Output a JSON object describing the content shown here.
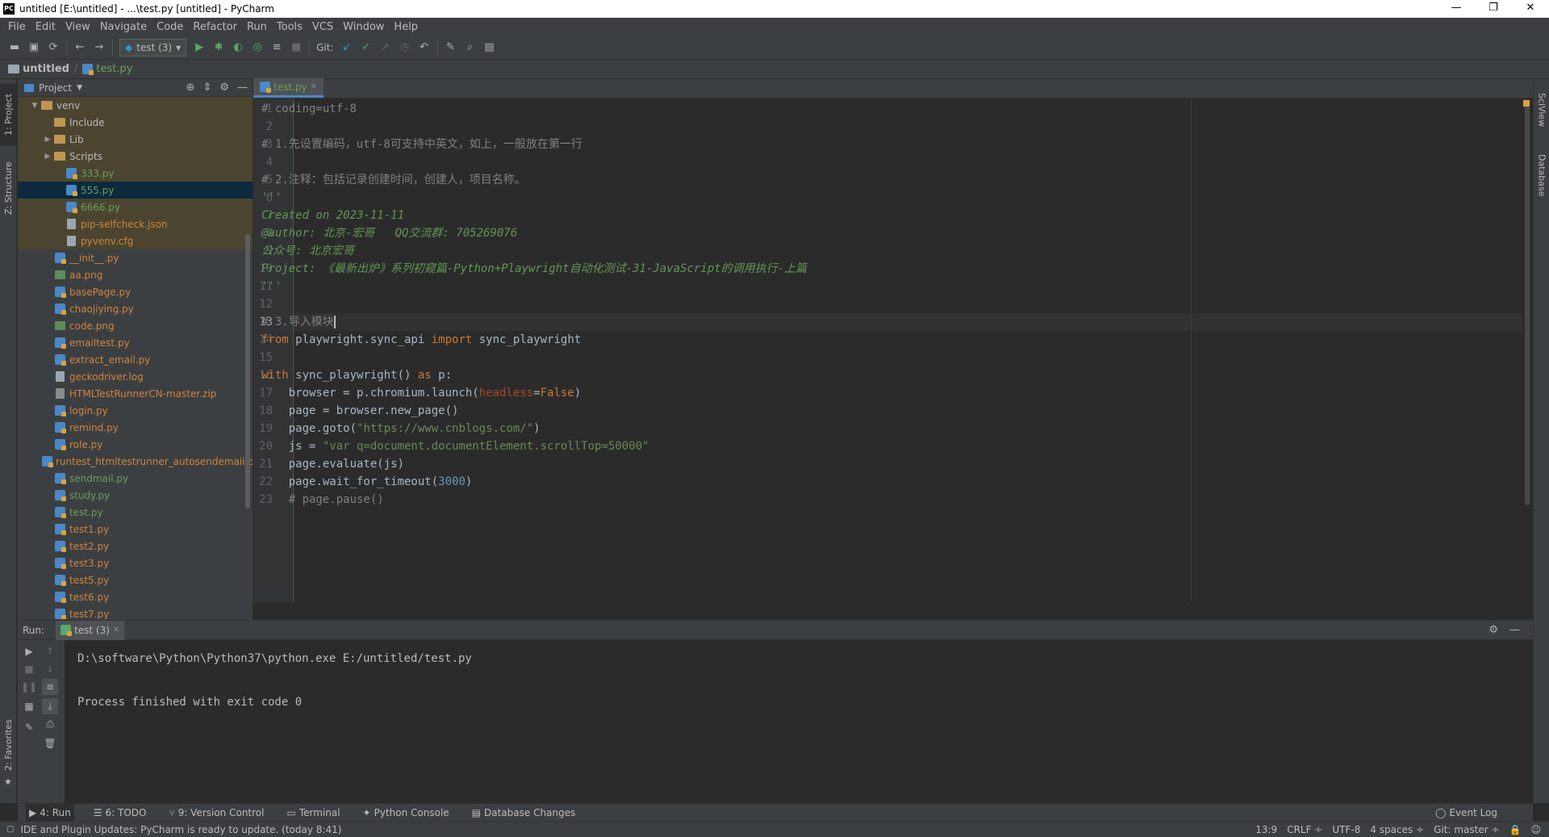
{
  "window": {
    "title": "untitled [E:\\untitled] - ...\\test.py [untitled] - PyCharm",
    "logo": "PC"
  },
  "menu": [
    "File",
    "Edit",
    "View",
    "Navigate",
    "Code",
    "Refactor",
    "Run",
    "Tools",
    "VCS",
    "Window",
    "Help"
  ],
  "toolbar": {
    "run_config": "test (3)",
    "git_label": "Git:"
  },
  "breadcrumb": {
    "project": "untitled",
    "file": "test.py"
  },
  "left_tabs": {
    "project": "1: Project",
    "structure": "Z: Structure",
    "favorites": "2: Favorites"
  },
  "right_tabs": {
    "sciview": "SciView",
    "database": "Database"
  },
  "project_panel": {
    "title": "Project",
    "items": [
      {
        "label": "venv",
        "type": "folder",
        "color": "#bbbbbb"
      },
      {
        "label": "Include",
        "type": "folder",
        "color": "#bbbbbb"
      },
      {
        "label": "Lib",
        "type": "folder",
        "color": "#bbbbbb"
      },
      {
        "label": "Scripts",
        "type": "folder",
        "color": "#bbbbbb"
      },
      {
        "label": "333.py",
        "type": "py",
        "color": "#6a9f5a"
      },
      {
        "label": "555.py",
        "type": "py",
        "color": "#6a9f5a"
      },
      {
        "label": "6666.py",
        "type": "py",
        "color": "#6a9f5a"
      },
      {
        "label": "pip-selfcheck.json",
        "type": "file",
        "color": "#d0843d"
      },
      {
        "label": "pyvenv.cfg",
        "type": "file",
        "color": "#d0843d"
      },
      {
        "label": "__init__.py",
        "type": "py",
        "color": "#d0843d"
      },
      {
        "label": "aa.png",
        "type": "img",
        "color": "#d0843d"
      },
      {
        "label": "basePage.py",
        "type": "py",
        "color": "#d0843d"
      },
      {
        "label": "chaojiying.py",
        "type": "py",
        "color": "#d0843d"
      },
      {
        "label": "code.png",
        "type": "img",
        "color": "#d0843d"
      },
      {
        "label": "emailtest.py",
        "type": "py",
        "color": "#d0843d"
      },
      {
        "label": "extract_email.py",
        "type": "py",
        "color": "#d0843d"
      },
      {
        "label": "geckodriver.log",
        "type": "file",
        "color": "#d0843d"
      },
      {
        "label": "HTMLTestRunnerCN-master.zip",
        "type": "zip",
        "color": "#d0843d"
      },
      {
        "label": "login.py",
        "type": "py",
        "color": "#d0843d"
      },
      {
        "label": "remind.py",
        "type": "py",
        "color": "#d0843d"
      },
      {
        "label": "role.py",
        "type": "py",
        "color": "#d0843d"
      },
      {
        "label": "runtest_htmltestrunner_autosendemail.py",
        "type": "py",
        "color": "#d0843d"
      },
      {
        "label": "sendmail.py",
        "type": "py",
        "color": "#6a9f5a"
      },
      {
        "label": "study.py",
        "type": "py",
        "color": "#6a9f5a"
      },
      {
        "label": "test.py",
        "type": "py",
        "color": "#6a9f5a"
      },
      {
        "label": "test1.py",
        "type": "py",
        "color": "#d0843d"
      },
      {
        "label": "test2.py",
        "type": "py",
        "color": "#d0843d"
      },
      {
        "label": "test3.py",
        "type": "py",
        "color": "#d0843d"
      },
      {
        "label": "test5.py",
        "type": "py",
        "color": "#d0843d"
      },
      {
        "label": "test6.py",
        "type": "py",
        "color": "#d0843d"
      },
      {
        "label": "test7.py",
        "type": "py",
        "color": "#d0843d"
      }
    ]
  },
  "editor": {
    "tab": "test.py",
    "lines": [
      {
        "n": "1",
        "parts": [
          [
            "cm",
            "# coding=utf-8"
          ]
        ]
      },
      {
        "n": "2",
        "parts": []
      },
      {
        "n": "3",
        "parts": [
          [
            "cm",
            "# 1.先设置编码，utf-8可支持中英文，如上，一般放在第一行"
          ]
        ]
      },
      {
        "n": "4",
        "parts": []
      },
      {
        "n": "5",
        "parts": [
          [
            "cm",
            "# 2.注释：包括记录创建时间，创建人，项目名称。"
          ]
        ]
      },
      {
        "n": "6",
        "parts": [
          [
            "doc",
            "'''"
          ]
        ]
      },
      {
        "n": "7",
        "parts": [
          [
            "doc",
            "Created on 2023-11-11"
          ]
        ]
      },
      {
        "n": "8",
        "parts": [
          [
            "doc",
            "@author: 北京-宏哥   QQ交流群: 705269076"
          ]
        ]
      },
      {
        "n": "9",
        "parts": [
          [
            "doc",
            "公众号: 北京宏哥"
          ]
        ]
      },
      {
        "n": "10",
        "parts": [
          [
            "doc",
            "Project: 《最新出炉》系列初窥篇-Python+Playwright自动化测试-31-JavaScript的调用执行-上篇"
          ]
        ]
      },
      {
        "n": "11",
        "parts": [
          [
            "doc",
            "'''"
          ]
        ]
      },
      {
        "n": "12",
        "parts": []
      },
      {
        "n": "13",
        "parts": [
          [
            "cm",
            "# 3.导入模块"
          ]
        ]
      },
      {
        "n": "14",
        "parts": [
          [
            "kw",
            "from"
          ],
          [
            "pl",
            " playwright.sync_api "
          ],
          [
            "kw",
            "import"
          ],
          [
            "pl",
            " sync_playwright"
          ]
        ]
      },
      {
        "n": "15",
        "parts": []
      },
      {
        "n": "16",
        "parts": [
          [
            "kw",
            "with"
          ],
          [
            "pl",
            " sync_playwright() "
          ],
          [
            "kw",
            "as"
          ],
          [
            "pl",
            " p:"
          ]
        ]
      },
      {
        "n": "17",
        "parts": [
          [
            "pl",
            "    browser = p.chromium.launch("
          ],
          [
            "par",
            "headless"
          ],
          [
            "pl",
            "="
          ],
          [
            "kw",
            "False"
          ],
          [
            "pl",
            ")"
          ]
        ]
      },
      {
        "n": "18",
        "parts": [
          [
            "pl",
            "    page = browser.new_page()"
          ]
        ]
      },
      {
        "n": "19",
        "parts": [
          [
            "pl",
            "    page.goto("
          ],
          [
            "str",
            "\"https://www.cnblogs.com/\""
          ],
          [
            "pl",
            ")"
          ]
        ]
      },
      {
        "n": "20",
        "parts": [
          [
            "pl",
            "    js = "
          ],
          [
            "str",
            "\"var q=document.documentElement.scrollTop=50000\""
          ]
        ]
      },
      {
        "n": "21",
        "parts": [
          [
            "pl",
            "    page.evaluate(js)"
          ]
        ]
      },
      {
        "n": "22",
        "parts": [
          [
            "pl",
            "    page.wait_for_timeout("
          ],
          [
            "num",
            "3000"
          ],
          [
            "pl",
            ")"
          ]
        ]
      },
      {
        "n": "23",
        "parts": [
          [
            "cm",
            "    # page.pause()"
          ]
        ]
      }
    ]
  },
  "run_panel": {
    "label": "Run:",
    "tab": "test (3)",
    "output": [
      "D:\\software\\Python\\Python37\\python.exe E:/untitled/test.py",
      "",
      "Process finished with exit code 0"
    ]
  },
  "bottom_tabs": [
    "4: Run",
    "6: TODO",
    "9: Version Control",
    "Terminal",
    "Python Console",
    "Database Changes"
  ],
  "event_log": "Event Log",
  "status": {
    "message": "IDE and Plugin Updates: PyCharm is ready to update. (today 8:41)",
    "position": "13:9",
    "line_sep": "CRLF ÷",
    "encoding": "UTF-8",
    "indent": "4 spaces ÷",
    "git": "Git: master ÷"
  }
}
